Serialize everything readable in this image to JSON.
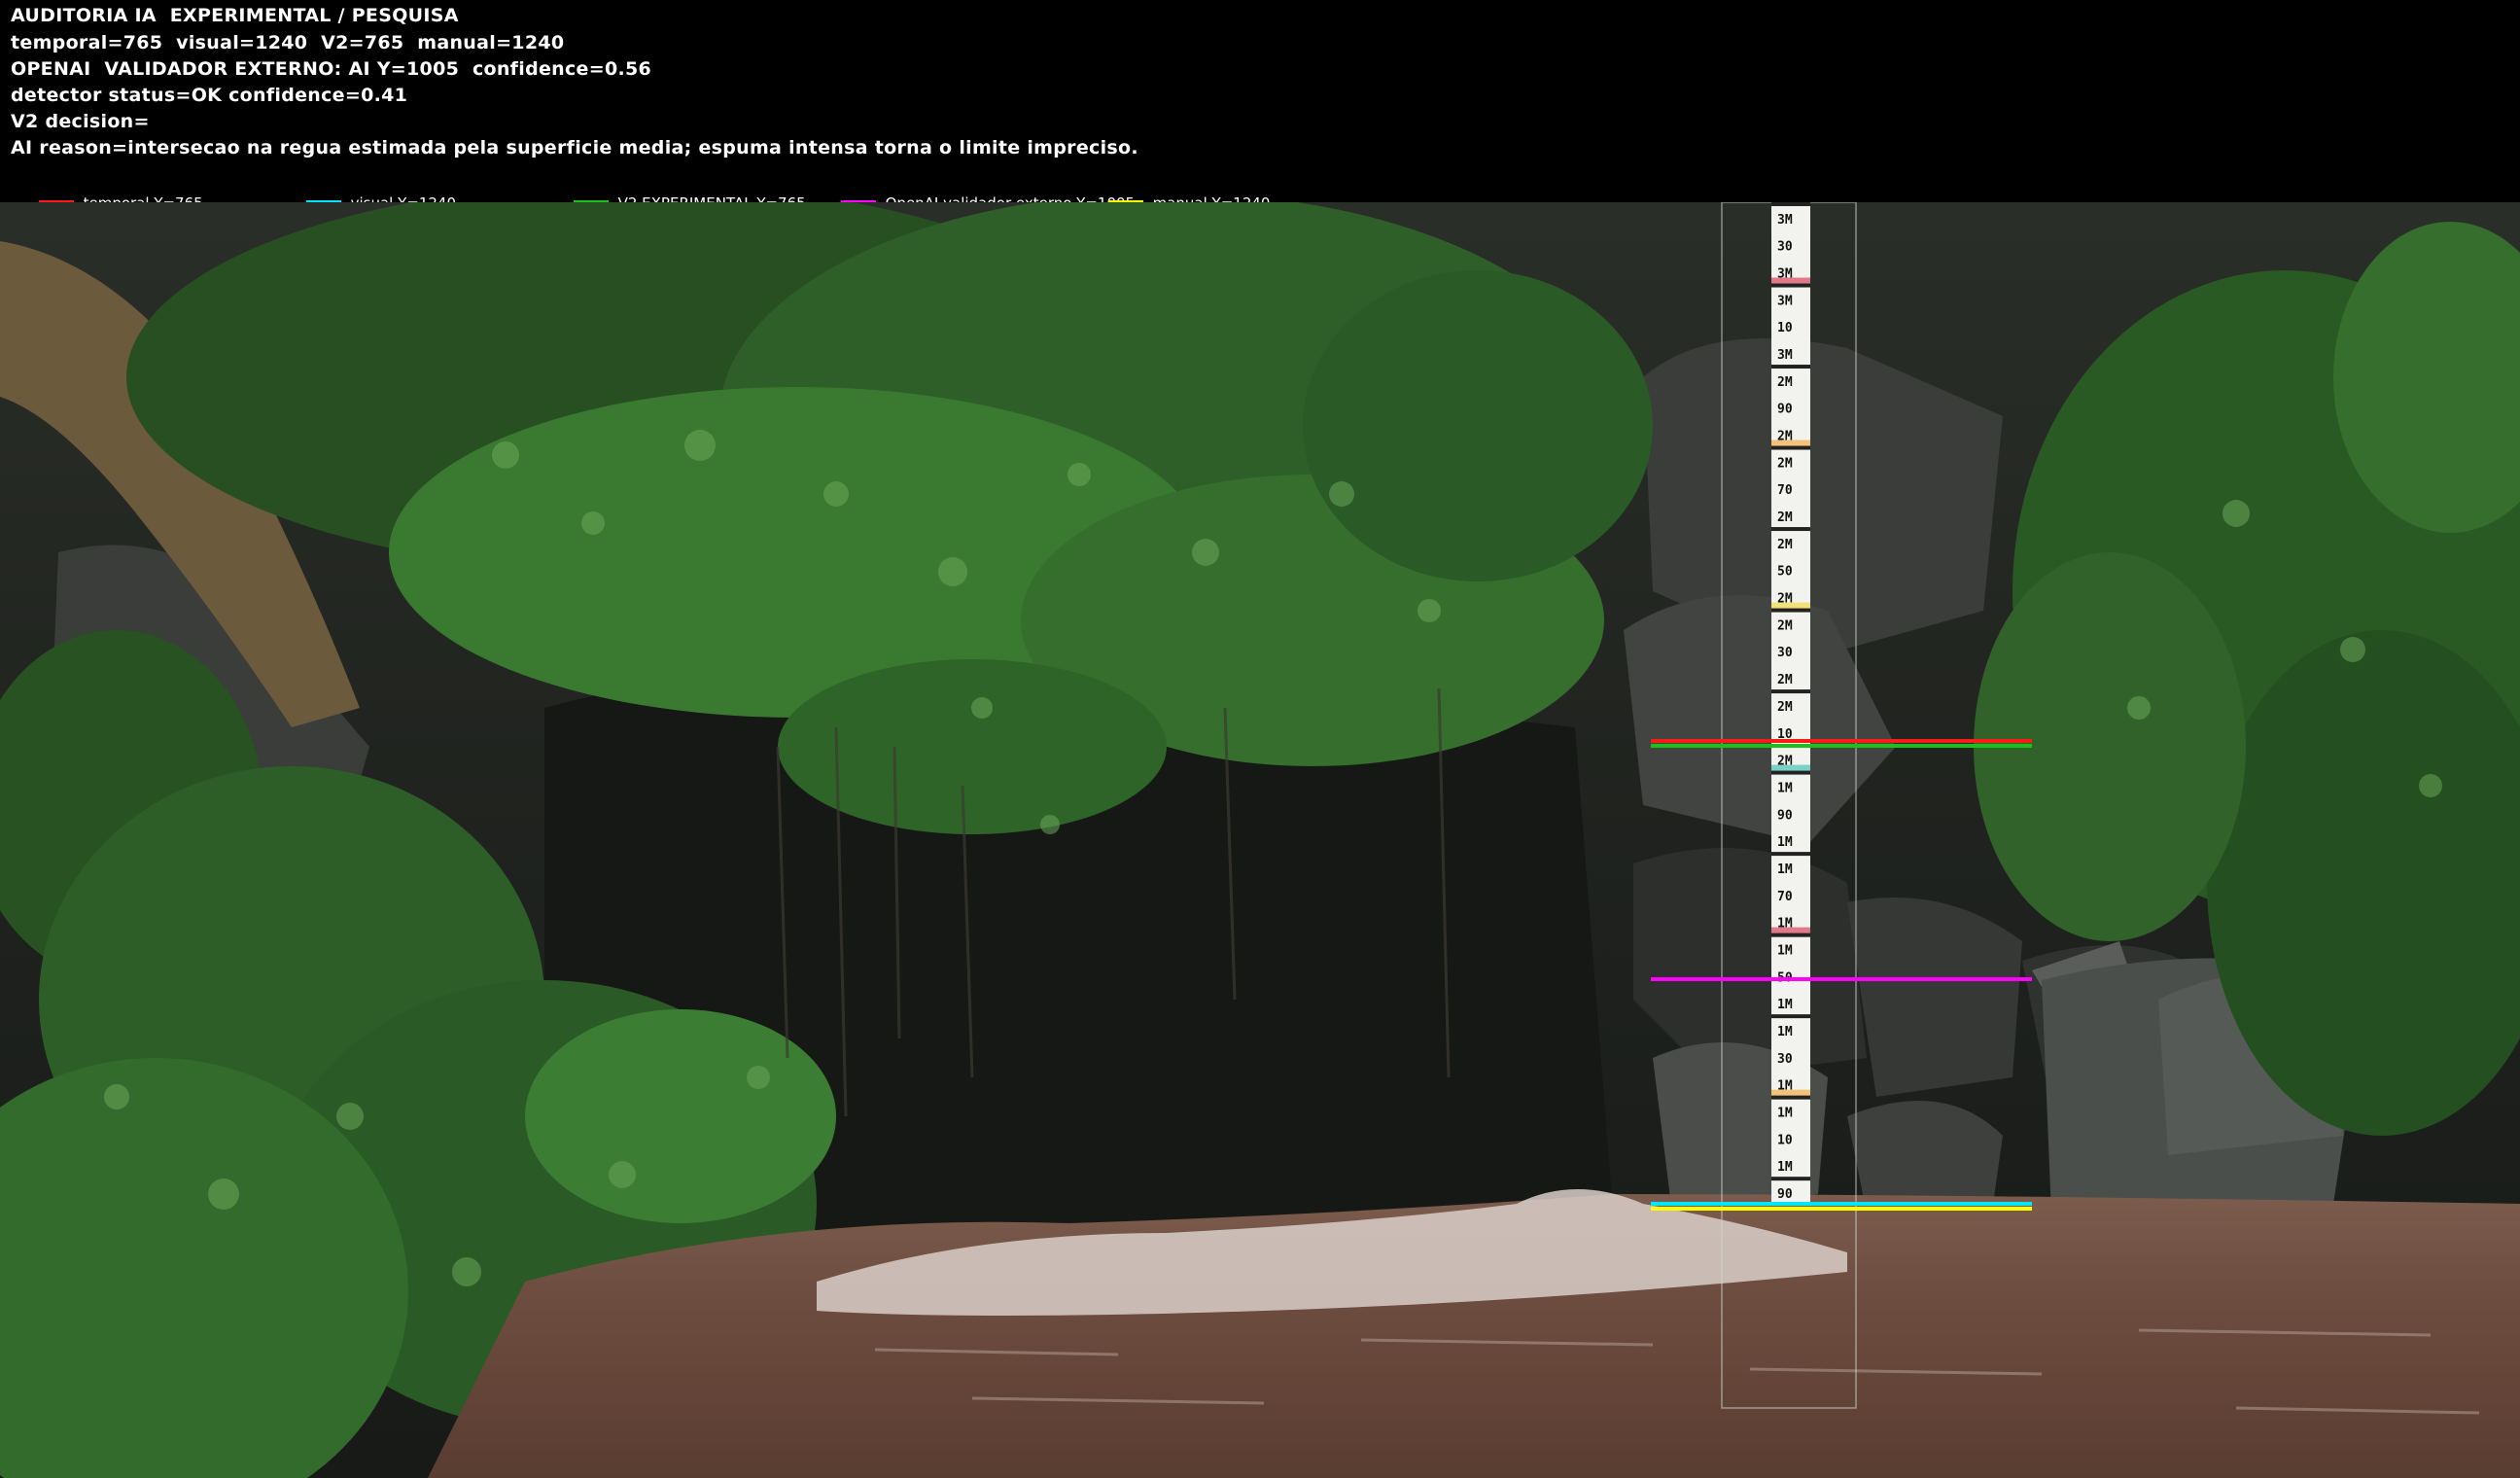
{
  "audit": {
    "title": "AUDITORIA IA  EXPERIMENTAL / PESQUISA",
    "metrics": "temporal=765  visual=1240  V2=765  manual=1240",
    "openai": "OPENAI  VALIDADOR EXTERNO: AI Y=1005  confidence=0.56",
    "detector": "detector status=OK confidence=0.41",
    "decision": "V2 decision=",
    "reason": "AI reason=intersecao na regua estimada pela superficie media; espuma intensa torna o limite impreciso."
  },
  "legend": [
    {
      "label": "temporal Y=765",
      "color": "#ff1a1a"
    },
    {
      "label": "visual Y=1240",
      "color": "#00e5ff"
    },
    {
      "label": "V2 EXPERIMENTAL Y=765",
      "color": "#19c219"
    },
    {
      "label": "OpenAI validador externo Y=1005",
      "color": "#ff00ff"
    },
    {
      "label": "manual Y=1240",
      "color": "#ffff00"
    }
  ],
  "gauge": {
    "labels": [
      "3M",
      "30",
      "3M",
      "3M",
      "10",
      "3M",
      "2M",
      "90",
      "2M",
      "2M",
      "70",
      "2M",
      "2M",
      "50",
      "2M",
      "2M",
      "30",
      "2M",
      "2M",
      "10",
      "2M",
      "1M",
      "90",
      "1M",
      "1M",
      "70",
      "1M",
      "1M",
      "50",
      "1M",
      "1M",
      "30",
      "1M",
      "1M",
      "10",
      "1M",
      "90"
    ]
  },
  "colors": {
    "temporal": "#ff1a1a",
    "visual": "#00e5ff",
    "v2": "#19c219",
    "openai": "#ff00ff",
    "manual": "#ffff00"
  }
}
